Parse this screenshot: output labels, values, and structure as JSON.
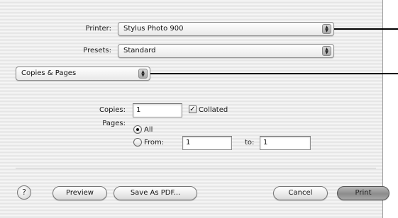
{
  "printer": {
    "label": "Printer:",
    "value": "Stylus Photo 900"
  },
  "presets": {
    "label": "Presets:",
    "value": "Standard"
  },
  "panel_selector": {
    "value": "Copies & Pages"
  },
  "copies": {
    "label": "Copies:",
    "value": "1",
    "collated_label": "Collated",
    "collated_checked": true
  },
  "pages": {
    "label": "Pages:",
    "all_label": "All",
    "from_label": "From:",
    "from_value": "1",
    "to_label": "to:",
    "to_value": "1",
    "selected": "All"
  },
  "buttons": {
    "help": "?",
    "preview": "Preview",
    "save_pdf": "Save As PDF...",
    "cancel": "Cancel",
    "print": "Print"
  },
  "icons": {
    "popup_arrows": "updown-arrows-icon",
    "help": "question-mark-icon"
  }
}
